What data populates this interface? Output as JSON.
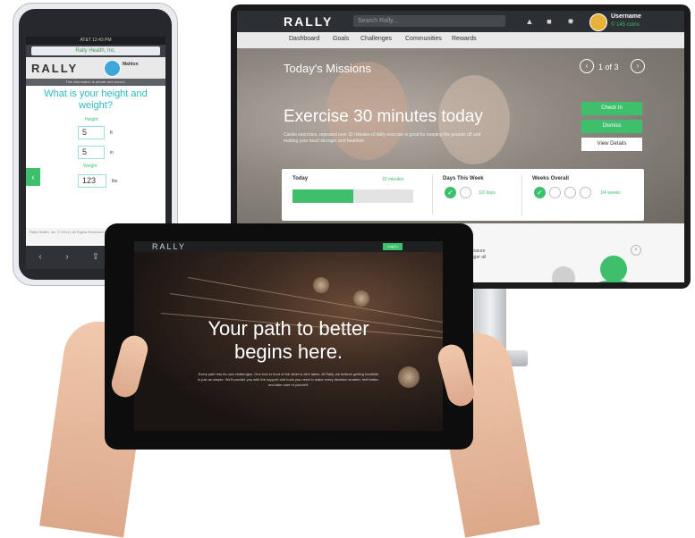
{
  "monitor": {
    "logo": "RALLY",
    "search_placeholder": "Search Rally...",
    "username": "Username",
    "coins": "© 145 coins",
    "nav": [
      "Dashboard",
      "Goals",
      "Challenges",
      "Communities",
      "Rewards"
    ],
    "missions_title": "Today's Missions",
    "paging": "1 of 3",
    "mission_heading": "Exercise 30 minutes today",
    "mission_desc": "Cardio exercises, repeated over 30 minutes of daily exercise is good for keeping the pounds off and making your heart stronger and healthier.",
    "check_in": "Check In",
    "dismiss": "Dismiss",
    "view_details": "View Details",
    "stats": {
      "today_label": "Today",
      "today_value": "10 minutes",
      "today_progress": 0.5,
      "days_label": "Days This Week",
      "days_value": "1/2 days",
      "weeks_label": "Weeks Overall",
      "weeks_value": "1/4 weeks"
    },
    "lower_text": "Measure\nbigger all"
  },
  "phone": {
    "status": "AT&T  12:43 PM",
    "url": "Rally Health, Inc.",
    "logo": "RALLY",
    "user": "Mahlon",
    "banner": "This information is private and secure.",
    "question": "What is your height and weight?",
    "height_label": "Height",
    "feet_value": "5",
    "feet_unit": "ft",
    "inches_value": "5",
    "inches_unit": "in",
    "weight_label": "Weight",
    "weight_value": "123",
    "weight_unit": "lbs",
    "footer": "Rally Health, Inc. © 2014  |  All Rights Reserved  FAQ  |  Privacy  |  Terms  |  Other"
  },
  "tablet": {
    "logo": "RALLY",
    "login": "Log In",
    "headline_line1": "Your path to better",
    "headline_line2": "begins here.",
    "subtext": "Every path has its own challenges. One foot in front of the other is all it takes. At Rally, we believe getting healthier is just as simple. We'll provide you with the support and tools you need to make every decision smarter, feel better, and take care of yourself."
  }
}
